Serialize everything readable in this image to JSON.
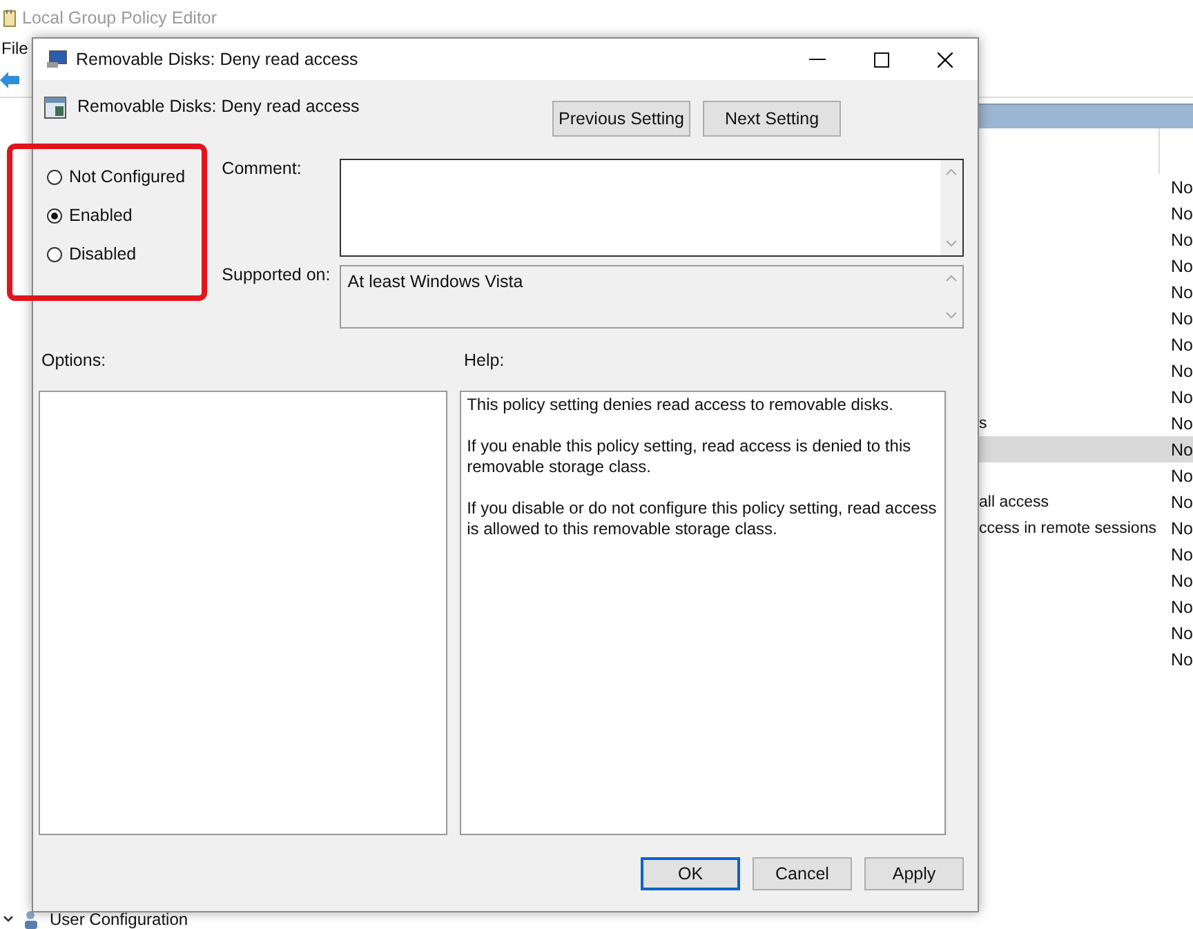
{
  "app": {
    "title": "Local Group Policy Editor",
    "menu": [
      "File"
    ],
    "tree_item": "User Configuration",
    "list_rows": [
      {
        "state": "No",
        "selected": false
      },
      {
        "state": "No",
        "selected": false
      },
      {
        "state": "No",
        "selected": false
      },
      {
        "state": "No",
        "selected": false
      },
      {
        "state": "No",
        "selected": false
      },
      {
        "state": "No",
        "selected": false
      },
      {
        "state": "No",
        "selected": false
      },
      {
        "state": "No",
        "selected": false
      },
      {
        "state": "No",
        "selected": false
      },
      {
        "name": "s",
        "state": "No",
        "selected": false
      },
      {
        "state": "No",
        "selected": true
      },
      {
        "state": "No",
        "selected": false
      },
      {
        "name": "all access",
        "state": "No",
        "selected": false
      },
      {
        "name": "ccess in remote sessions",
        "state": "No",
        "selected": false
      },
      {
        "state": "No",
        "selected": false
      },
      {
        "state": "No",
        "selected": false
      },
      {
        "state": "No",
        "selected": false
      },
      {
        "state": "No",
        "selected": false
      },
      {
        "state": "No",
        "selected": false
      }
    ]
  },
  "dialog": {
    "title": "Removable Disks: Deny read access",
    "setting_title": "Removable Disks: Deny read access",
    "nav_buttons": [
      "Previous Setting",
      "Next Setting"
    ],
    "radios": [
      {
        "label": "Not Configured",
        "selected": false
      },
      {
        "label": "Enabled",
        "selected": true
      },
      {
        "label": "Disabled",
        "selected": false
      }
    ],
    "comment_label": "Comment:",
    "supported_label": "Supported on:",
    "supported": "At least Windows Vista",
    "options_label": "Options:",
    "help_label": "Help:",
    "help": [
      "This policy setting denies read access to removable disks.",
      "If you enable this policy setting, read access is denied to this removable storage class.",
      "If you disable or do not configure this policy setting, read access is allowed to this removable storage class."
    ],
    "buttons": [
      {
        "label": "OK",
        "default": true
      },
      {
        "label": "Cancel",
        "default": false
      },
      {
        "label": "Apply",
        "default": false
      }
    ]
  }
}
